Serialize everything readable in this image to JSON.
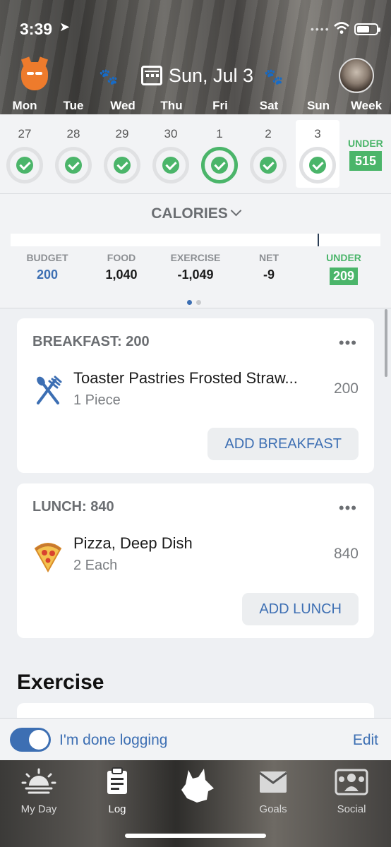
{
  "status_bar": {
    "time": "3:39"
  },
  "header": {
    "date": "Sun, Jul 3"
  },
  "week": {
    "day_names": [
      "Mon",
      "Tue",
      "Wed",
      "Thu",
      "Fri",
      "Sat",
      "Sun",
      "Week"
    ],
    "dates": [
      "27",
      "28",
      "29",
      "30",
      "1",
      "2",
      "3"
    ],
    "under_label": "UNDER",
    "under_value": "515"
  },
  "summary": {
    "metric": "CALORIES",
    "budget_label": "BUDGET",
    "budget": "200",
    "food_label": "FOOD",
    "food": "1,040",
    "exercise_label": "EXERCISE",
    "exercise": "-1,049",
    "net_label": "NET",
    "net": "-9",
    "under_label": "UNDER",
    "under": "209"
  },
  "meals": [
    {
      "title": "BREAKFAST: 200",
      "food": "Toaster Pastries Frosted Straw...",
      "qty": "1 Piece",
      "cal": "200",
      "add": "ADD BREAKFAST"
    },
    {
      "title": "LUNCH: 840",
      "food": "Pizza, Deep Dish",
      "qty": "2 Each",
      "cal": "840",
      "add": "ADD LUNCH"
    }
  ],
  "exercise_title": "Exercise",
  "done_bar": {
    "label": "I'm done logging",
    "edit": "Edit",
    "toggle_on": true
  },
  "tabs": [
    {
      "label": "My Day",
      "icon": "sunrise-icon"
    },
    {
      "label": "Log",
      "icon": "clipboard-icon"
    },
    {
      "label": "",
      "icon": "wolf-icon"
    },
    {
      "label": "Goals",
      "icon": "envelope-icon"
    },
    {
      "label": "Social",
      "icon": "people-icon"
    }
  ],
  "colors": {
    "accent": "#3d6fb3",
    "green": "#4bb56a",
    "orange": "#ee7b2c"
  }
}
